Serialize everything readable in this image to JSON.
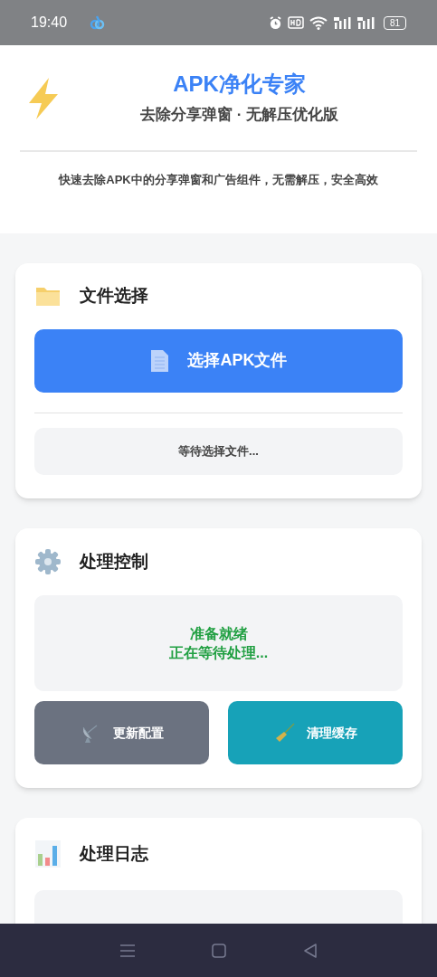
{
  "status_bar": {
    "time": "19:40",
    "battery": "81"
  },
  "header": {
    "title": "APK净化专家",
    "subtitle": "去除分享弹窗 · 无解压优化版",
    "description": "快速去除APK中的分享弹窗和广告组件，无需解压，安全高效"
  },
  "file_card": {
    "title": "文件选择",
    "button": "选择APK文件",
    "status": "等待选择文件..."
  },
  "control_card": {
    "title": "处理控制",
    "status_lines": [
      "准备就绪",
      "正在等待处理..."
    ],
    "buttons": [
      {
        "label": "更新配置",
        "kind": "config"
      },
      {
        "label": "清理缓存",
        "kind": "clean"
      }
    ]
  },
  "log_card": {
    "title": "处理日志"
  }
}
